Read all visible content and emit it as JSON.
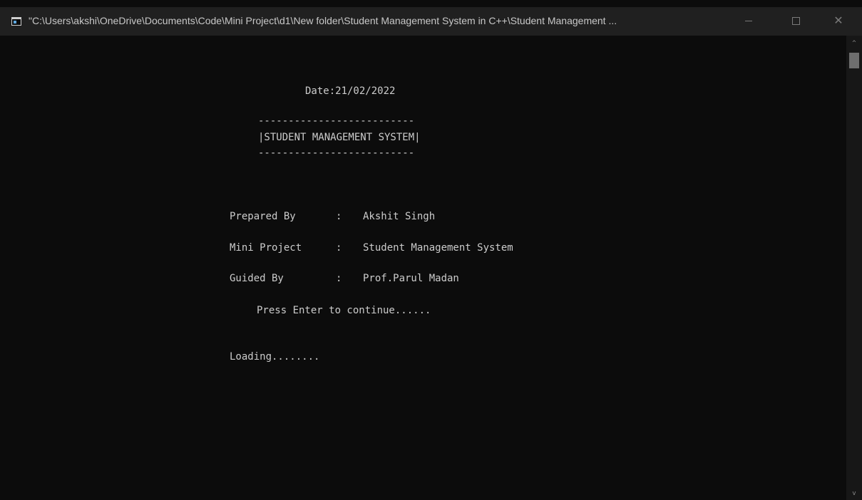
{
  "window": {
    "title": "\"C:\\Users\\akshi\\OneDrive\\Documents\\Code\\Mini Project\\d1\\New folder\\Student Management System in C++\\Student Management ...",
    "icon": "console-app-icon",
    "controls": {
      "minimize_icon": "minimize-icon",
      "maximize_icon": "maximize-icon",
      "close_icon": "close-icon",
      "close_glyph": "✕"
    }
  },
  "console": {
    "date_line": "Date:21/02/2022",
    "banner_top": "--------------------------",
    "banner_title": "|STUDENT MANAGEMENT SYSTEM|",
    "banner_bottom": "--------------------------",
    "prepared_by": {
      "label": "Prepared By",
      "sep": ":",
      "value": "Akshit Singh"
    },
    "mini_project": {
      "label": "Mini Project",
      "sep": ":",
      "value": "Student Management System"
    },
    "guided_by": {
      "label": "Guided By",
      "sep": ":",
      "value": "Prof.Parul Madan"
    },
    "prompt": "Press Enter to continue......",
    "loading": "Loading........"
  },
  "scrollbar": {
    "up_glyph": "^",
    "down_glyph": "v"
  }
}
